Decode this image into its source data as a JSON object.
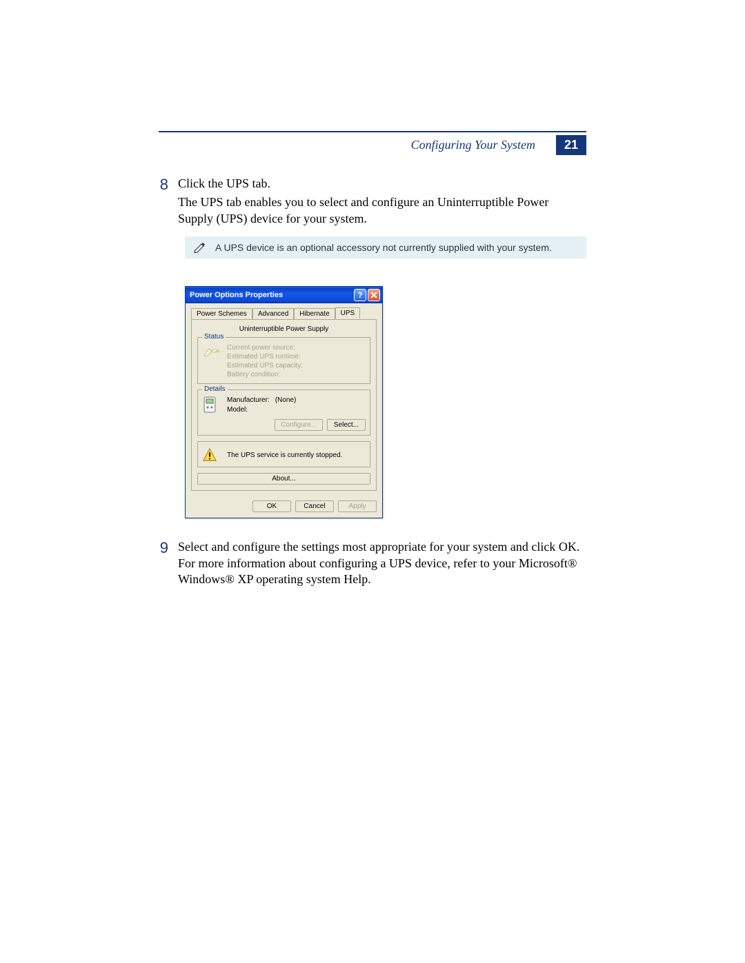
{
  "header": {
    "section": "Configuring Your System",
    "page_number": "21"
  },
  "step8": {
    "num": "8",
    "line1": "Click the UPS tab.",
    "line2": "The UPS tab enables you to select and configure an Uninterruptible Power Supply (UPS) device for your system."
  },
  "note": {
    "text": "A UPS device is an optional accessory not currently supplied with your system."
  },
  "dialog": {
    "title": "Power Options Properties",
    "help_symbol": "?",
    "tabs": {
      "power_schemes": "Power Schemes",
      "advanced": "Advanced",
      "hibernate": "Hibernate",
      "ups": "UPS"
    },
    "subheader": "Uninterruptible Power Supply",
    "status": {
      "legend": "Status",
      "l1": "Current power source:",
      "l2": "Estimated UPS runtime:",
      "l3": "Estimated UPS capacity:",
      "l4": "Battery condition:"
    },
    "details": {
      "legend": "Details",
      "manufacturer_label": "Manufacturer:",
      "manufacturer_value": "(None)",
      "model_label": "Model:",
      "configure_btn": "Configure...",
      "select_btn": "Select..."
    },
    "warning": "The UPS service is currently stopped.",
    "about_btn": "About...",
    "ok": "OK",
    "cancel": "Cancel",
    "apply": "Apply"
  },
  "step9": {
    "num": "9",
    "text": "Select and configure the settings most appropriate for your system and click OK. For more information about configuring a UPS device, refer to your Microsoft® Windows® XP operating system Help."
  }
}
